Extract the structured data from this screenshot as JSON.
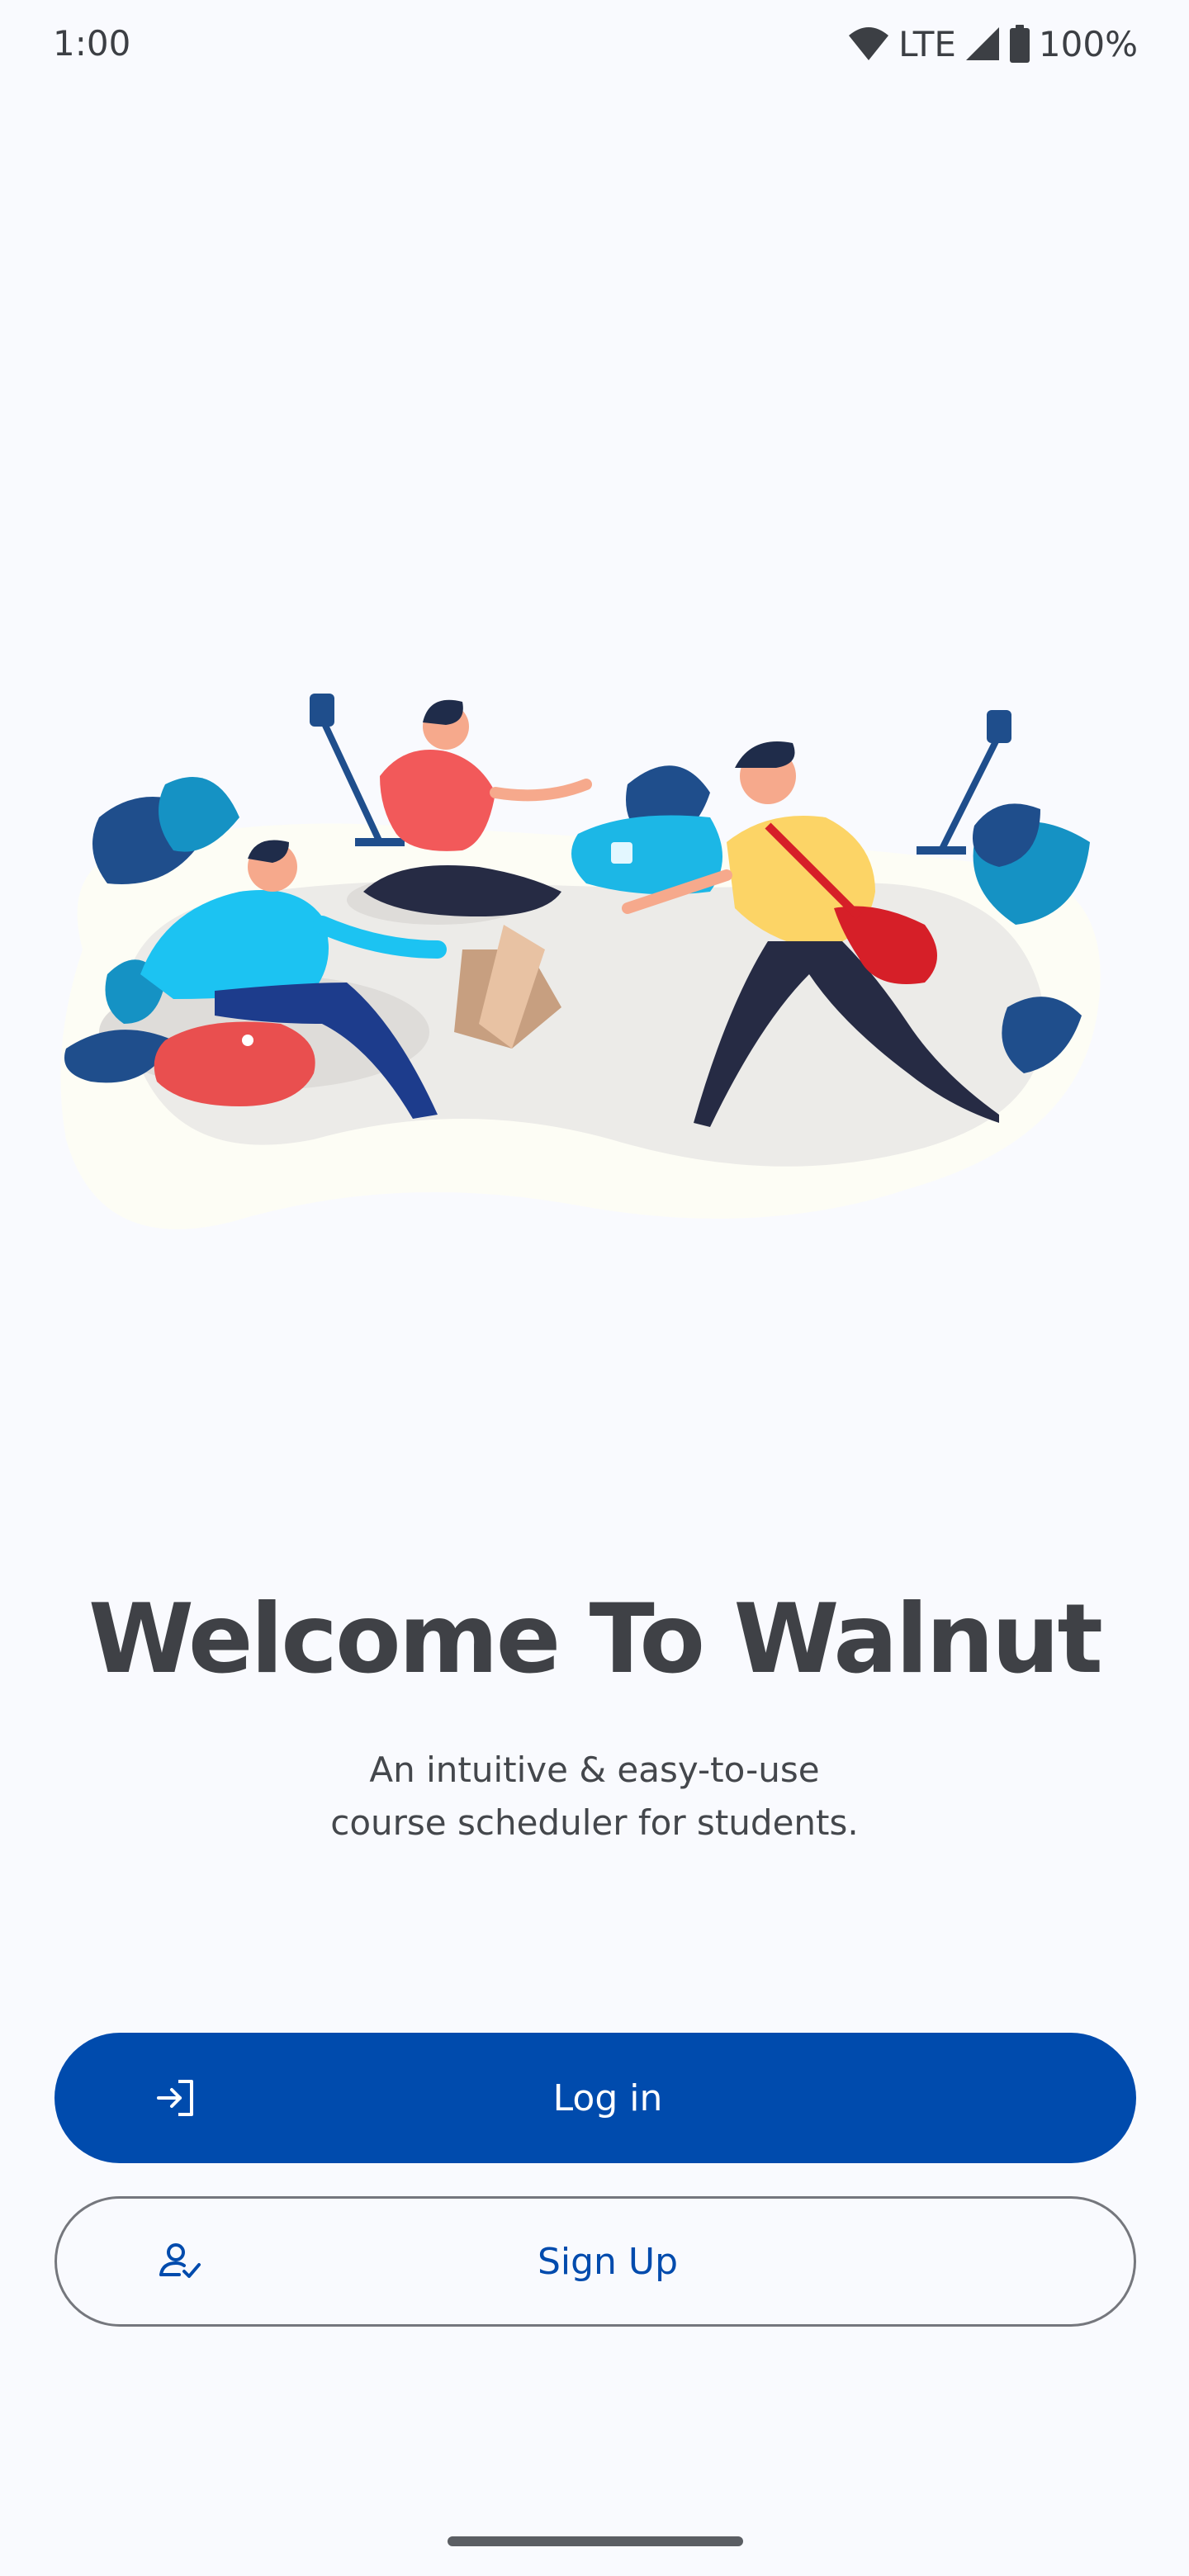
{
  "status_bar": {
    "time": "1:00",
    "network": "LTE",
    "battery": "100%",
    "icons": [
      "wifi-icon",
      "cell-signal-icon",
      "battery-icon"
    ]
  },
  "illustration": {
    "description_icon": "students-illustration"
  },
  "welcome": {
    "title": "Welcome To Walnut",
    "subtitle_line1": "An intuitive & easy-to-use",
    "subtitle_line2": "course scheduler for students."
  },
  "actions": {
    "login_label": "Log in",
    "login_icon": "login-arrow-icon",
    "signup_label": "Sign Up",
    "signup_icon": "person-check-icon"
  },
  "colors": {
    "background": "#f9fafe",
    "primary": "#004bad",
    "title_text": "#3f4146",
    "outline": "#75777d"
  }
}
